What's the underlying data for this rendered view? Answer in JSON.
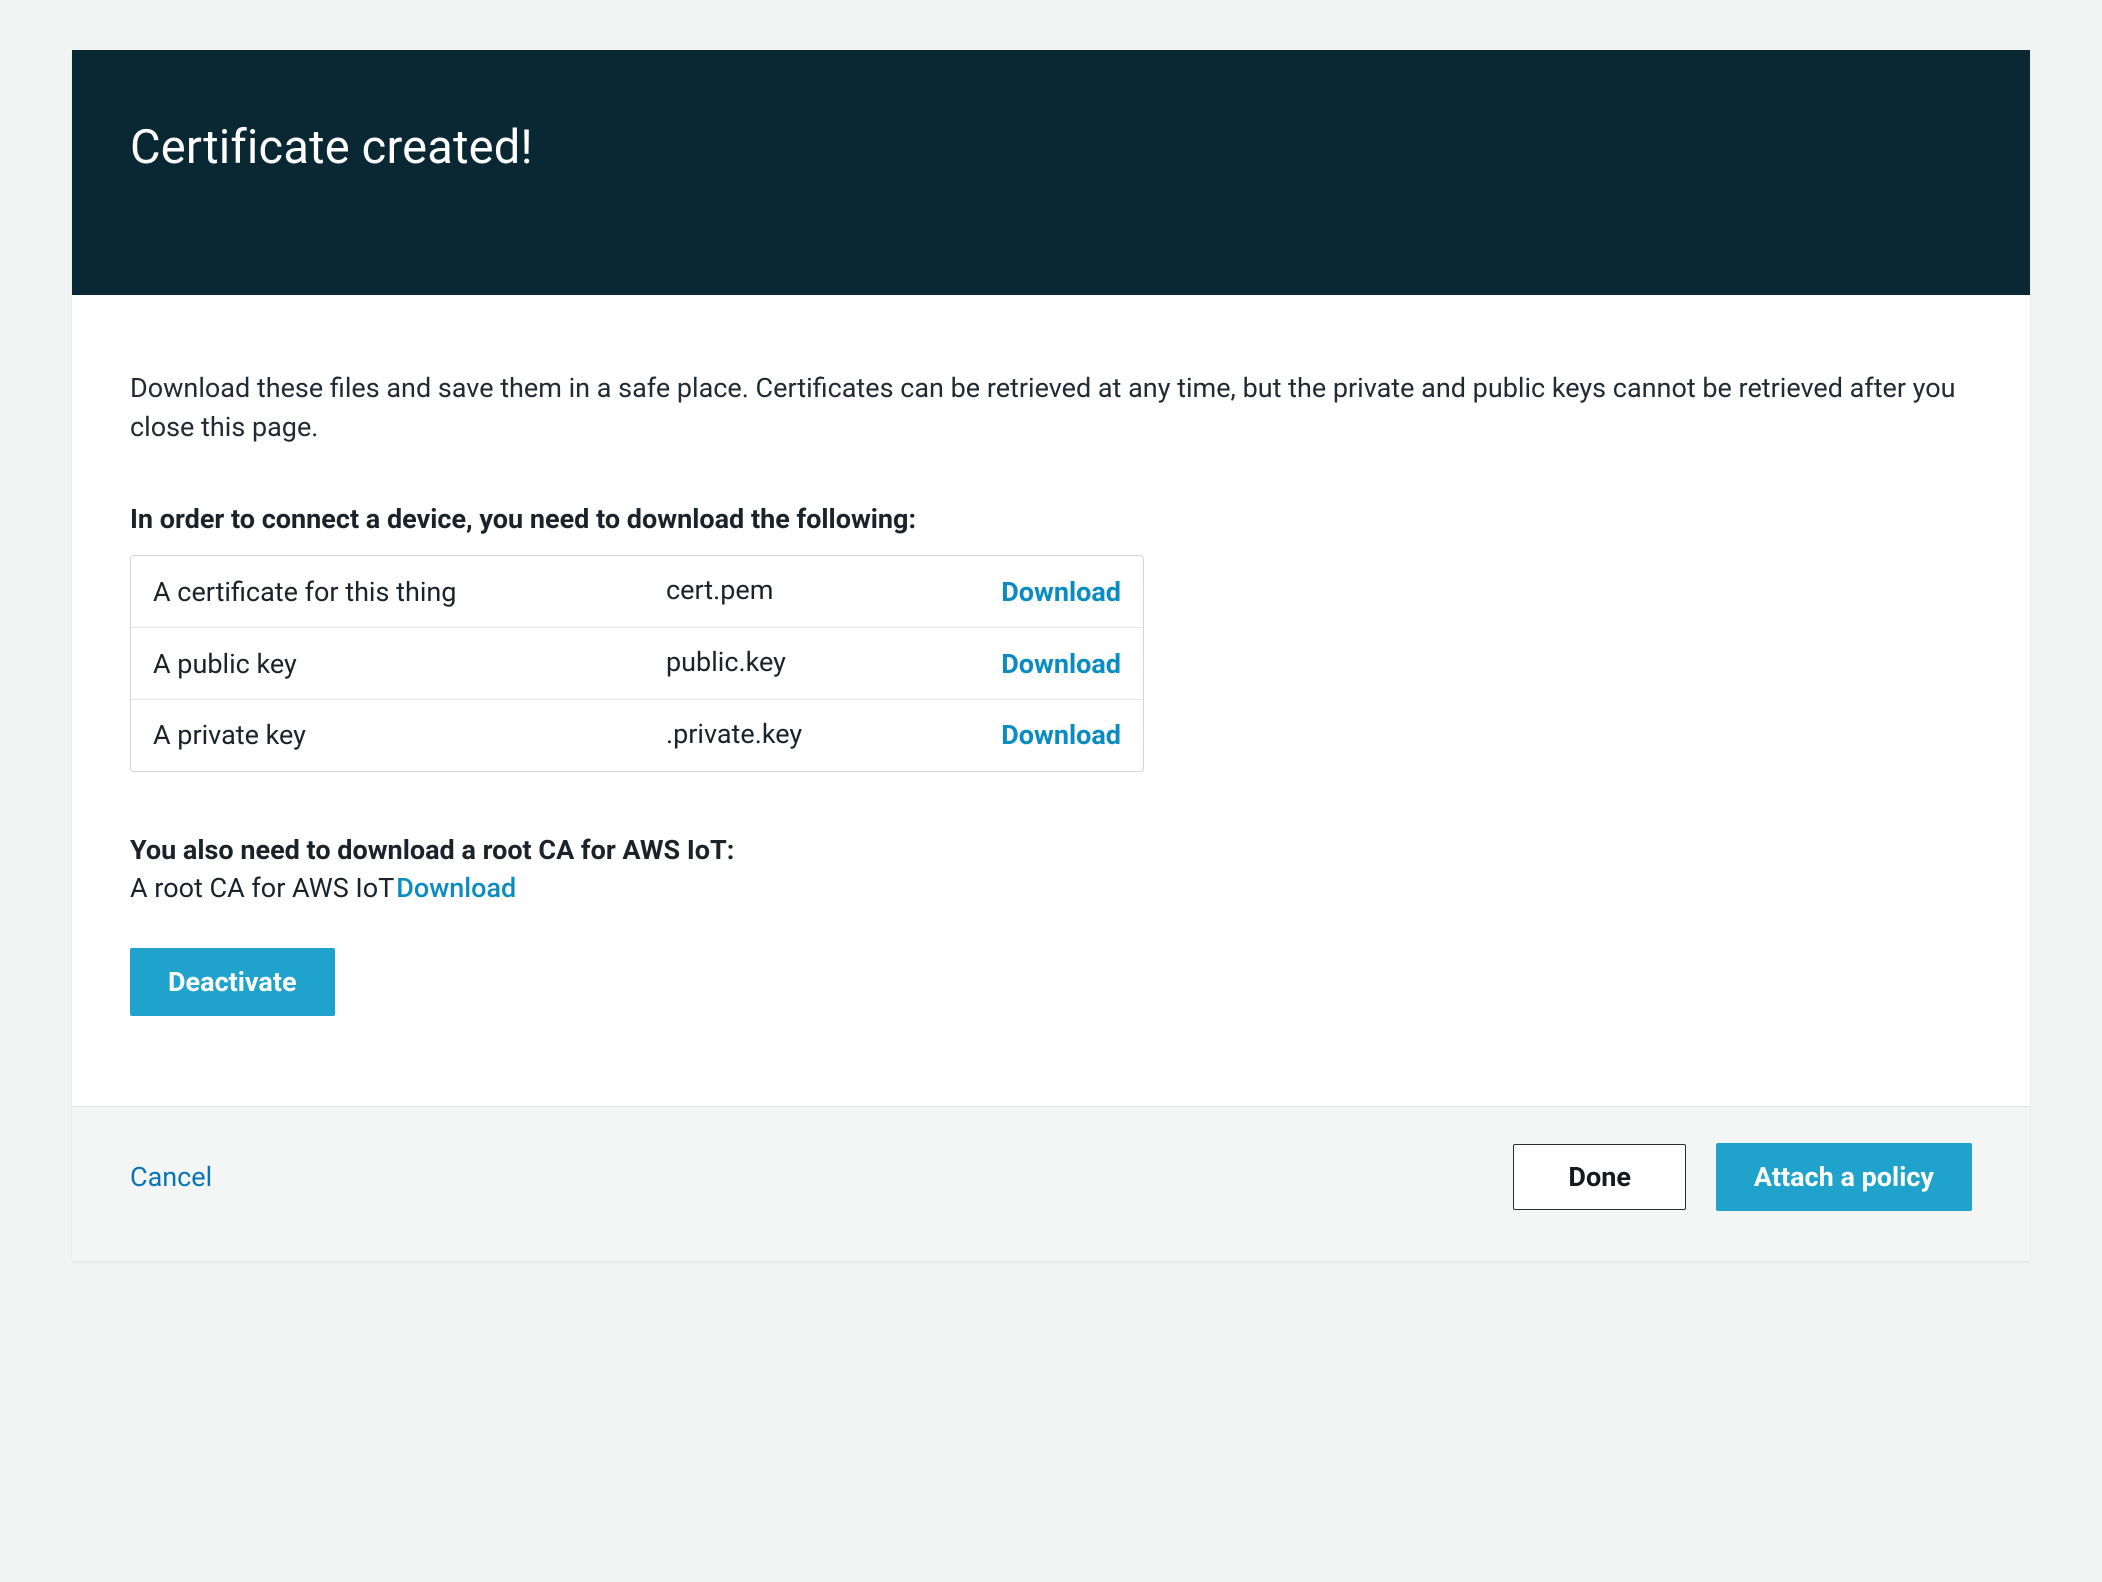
{
  "header": {
    "title": "Certificate created!"
  },
  "intro": "Download these files and save them in a safe place. Certificates can be retrieved at any time, but the private and public keys cannot be retrieved after you close this page.",
  "section_title": "In order to connect a device, you need to download the following:",
  "downloads": [
    {
      "label": "A certificate for this thing",
      "filename_suffix": "cert.pem",
      "action": "Download"
    },
    {
      "label": "A public key",
      "filename_suffix": "public.key",
      "action": "Download"
    },
    {
      "label": "A private key",
      "filename_suffix": ".private.key",
      "action": "Download"
    }
  ],
  "rootca": {
    "title": "You also need to download a root CA for AWS IoT:",
    "text": "A root CA for AWS IoT",
    "action": "Download"
  },
  "buttons": {
    "deactivate": "Deactivate",
    "cancel": "Cancel",
    "done": "Done",
    "attach": "Attach a policy"
  }
}
